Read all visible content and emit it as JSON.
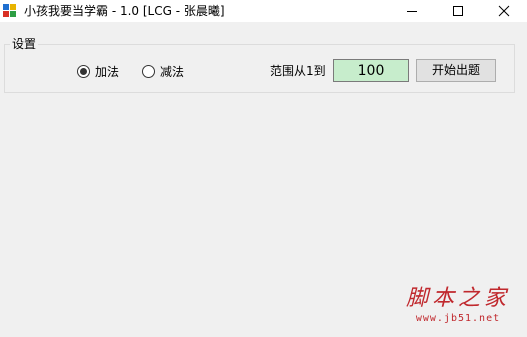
{
  "window": {
    "title": "小孩我要当学霸 - 1.0 [LCG - 张晨曦]",
    "minimize_glyph": "minimize-icon",
    "maximize_glyph": "maximize-icon",
    "close_glyph": "close-icon"
  },
  "settings": {
    "group_title": "设置",
    "options": [
      {
        "label": "加法",
        "checked": true
      },
      {
        "label": "减法",
        "checked": false
      }
    ],
    "range_label": "范围从1到",
    "range_value": "100",
    "start_button_label": "开始出题"
  },
  "watermark": {
    "title": "脚本之家",
    "url": "www.jb51.net"
  },
  "colors": {
    "input_background": "#c7edcc",
    "watermark": "#c0282d",
    "window_background": "#f0f0f0"
  }
}
